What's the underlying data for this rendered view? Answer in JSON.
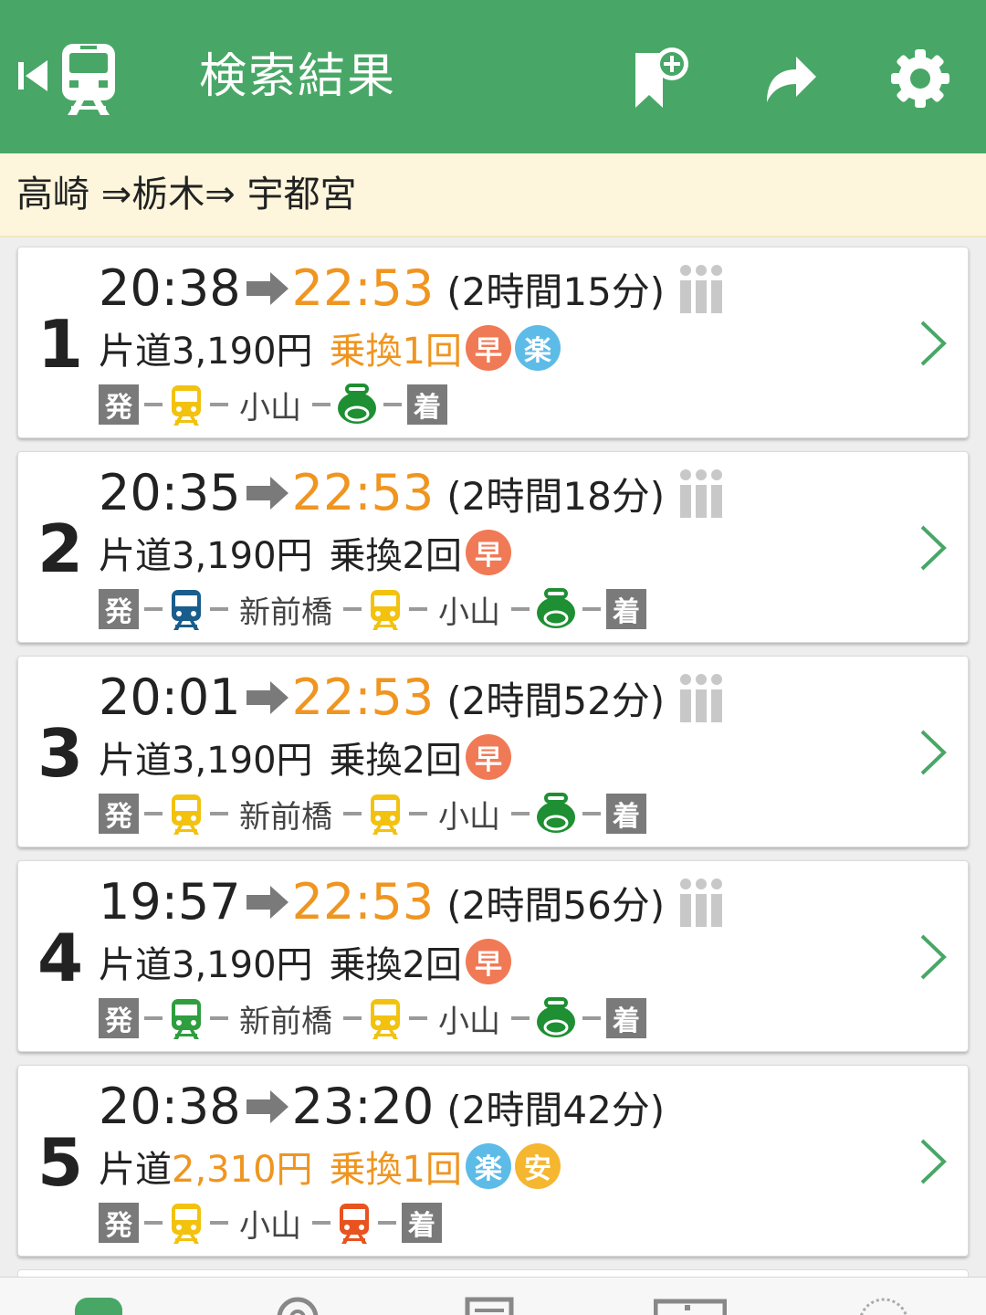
{
  "header": {
    "title": "検索結果",
    "colors": {
      "bar": "#48a766",
      "icon": "#ffffff"
    }
  },
  "route": {
    "text": "高崎 ⇒栃木⇒ 宇都宮"
  },
  "results": [
    {
      "index": "1",
      "dep": "20:38",
      "arr": "22:53",
      "arr_fast": true,
      "duration": "(2時間15分)",
      "seat_icon": true,
      "fare_label": "片道",
      "fare": "3,190円",
      "fare_cheap": false,
      "transfers": "乗換1回",
      "transfers_few": true,
      "badges": [
        {
          "text": "早",
          "kind": "haya"
        },
        {
          "text": "楽",
          "kind": "raku"
        }
      ],
      "path": [
        {
          "type": "box",
          "text": "発"
        },
        {
          "type": "train",
          "color": "#f2c20f"
        },
        {
          "type": "station",
          "text": "小山"
        },
        {
          "type": "bag",
          "color": "#1e8f32"
        },
        {
          "type": "box",
          "text": "着"
        }
      ]
    },
    {
      "index": "2",
      "dep": "20:35",
      "arr": "22:53",
      "arr_fast": true,
      "duration": "(2時間18分)",
      "seat_icon": true,
      "fare_label": "片道",
      "fare": "3,190円",
      "fare_cheap": false,
      "transfers": "乗換2回",
      "transfers_few": false,
      "badges": [
        {
          "text": "早",
          "kind": "haya"
        }
      ],
      "path": [
        {
          "type": "box",
          "text": "発"
        },
        {
          "type": "train",
          "color": "#1a5d8c"
        },
        {
          "type": "station",
          "text": "新前橋"
        },
        {
          "type": "train",
          "color": "#f2c20f"
        },
        {
          "type": "station",
          "text": "小山"
        },
        {
          "type": "bag",
          "color": "#1e8f32"
        },
        {
          "type": "box",
          "text": "着"
        }
      ]
    },
    {
      "index": "3",
      "dep": "20:01",
      "arr": "22:53",
      "arr_fast": true,
      "duration": "(2時間52分)",
      "seat_icon": true,
      "fare_label": "片道",
      "fare": "3,190円",
      "fare_cheap": false,
      "transfers": "乗換2回",
      "transfers_few": false,
      "badges": [
        {
          "text": "早",
          "kind": "haya"
        }
      ],
      "path": [
        {
          "type": "box",
          "text": "発"
        },
        {
          "type": "train",
          "color": "#f2c20f"
        },
        {
          "type": "station",
          "text": "新前橋"
        },
        {
          "type": "train",
          "color": "#f2c20f"
        },
        {
          "type": "station",
          "text": "小山"
        },
        {
          "type": "bag",
          "color": "#1e8f32"
        },
        {
          "type": "box",
          "text": "着"
        }
      ]
    },
    {
      "index": "4",
      "dep": "19:57",
      "arr": "22:53",
      "arr_fast": true,
      "duration": "(2時間56分)",
      "seat_icon": true,
      "fare_label": "片道",
      "fare": "3,190円",
      "fare_cheap": false,
      "transfers": "乗換2回",
      "transfers_few": false,
      "badges": [
        {
          "text": "早",
          "kind": "haya"
        }
      ],
      "path": [
        {
          "type": "box",
          "text": "発"
        },
        {
          "type": "train",
          "color": "#2e9e3e"
        },
        {
          "type": "station",
          "text": "新前橋"
        },
        {
          "type": "train",
          "color": "#f2c20f"
        },
        {
          "type": "station",
          "text": "小山"
        },
        {
          "type": "bag",
          "color": "#1e8f32"
        },
        {
          "type": "box",
          "text": "着"
        }
      ]
    },
    {
      "index": "5",
      "dep": "20:38",
      "arr": "23:20",
      "arr_fast": false,
      "duration": "(2時間42分)",
      "seat_icon": false,
      "fare_label": "片道",
      "fare": "2,310円",
      "fare_cheap": true,
      "transfers": "乗換1回",
      "transfers_few": true,
      "badges": [
        {
          "text": "楽",
          "kind": "raku"
        },
        {
          "text": "安",
          "kind": "yasu"
        }
      ],
      "path": [
        {
          "type": "box",
          "text": "発"
        },
        {
          "type": "train",
          "color": "#f2c20f"
        },
        {
          "type": "station",
          "text": "小山"
        },
        {
          "type": "train",
          "color": "#e8531f"
        },
        {
          "type": "box",
          "text": "着"
        }
      ]
    }
  ],
  "tabs": [
    {
      "icon": "train-icon",
      "active": true
    },
    {
      "icon": "location-pin-icon",
      "active": false
    },
    {
      "icon": "timetable-icon",
      "active": false
    },
    {
      "icon": "calendar-icon",
      "active": false
    },
    {
      "icon": "clock-icon",
      "active": false
    }
  ],
  "colors": {
    "accent": "#ef9520",
    "chevron": "#48a766",
    "box": "#7a7a7a"
  }
}
